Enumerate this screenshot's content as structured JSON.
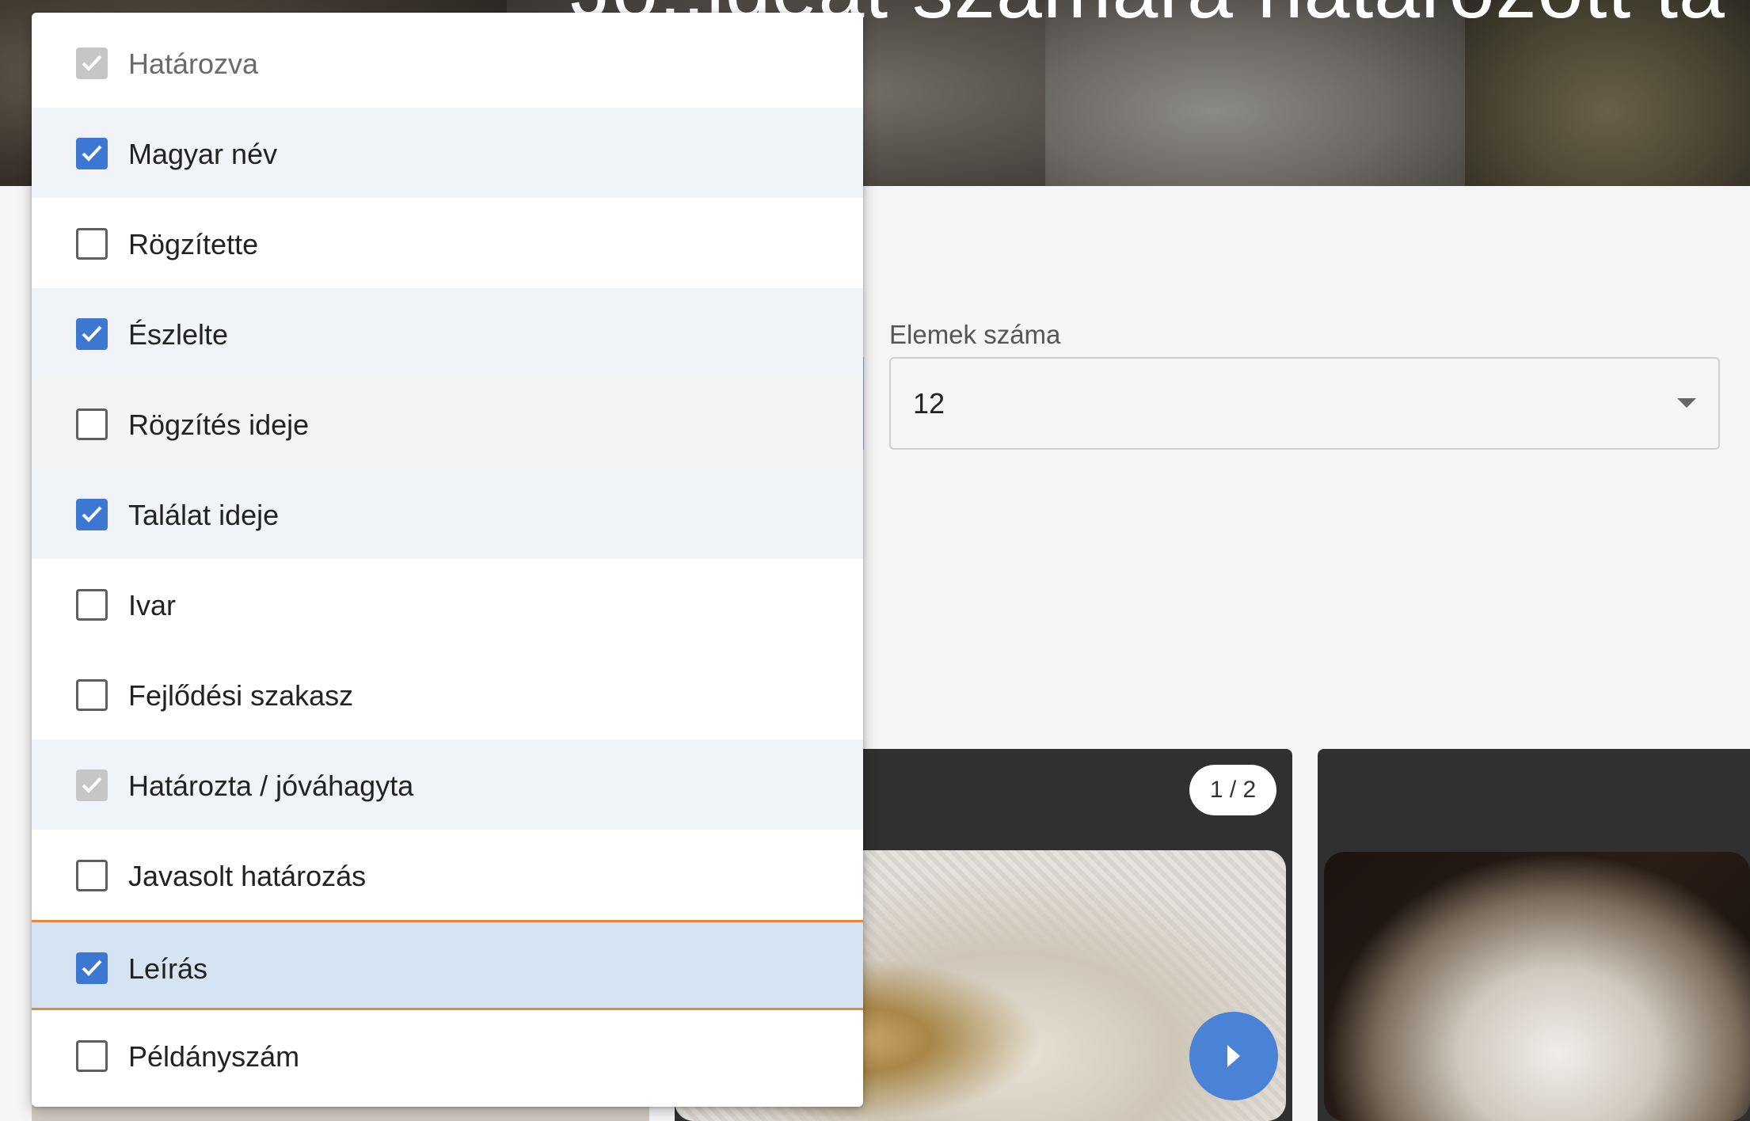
{
  "hero": {
    "title": "Jó..ldeat számára határozott ta"
  },
  "items_per_page": {
    "label": "Elemek száma",
    "value": "12"
  },
  "card": {
    "counter": "1 / 2"
  },
  "column_options": [
    {
      "label": "Határozva",
      "state": "checked-disabled"
    },
    {
      "label": "Magyar név",
      "state": "checked"
    },
    {
      "label": "Rögzítette",
      "state": "unchecked"
    },
    {
      "label": "Észlelte",
      "state": "checked"
    },
    {
      "label": "Rögzítés ideje",
      "state": "unchecked"
    },
    {
      "label": "Találat ideje",
      "state": "checked"
    },
    {
      "label": "Ivar",
      "state": "unchecked"
    },
    {
      "label": "Fejlődési szakasz",
      "state": "unchecked"
    },
    {
      "label": "Határozta / jóváhagyta",
      "state": "checked-disabled"
    },
    {
      "label": "Javasolt határozás",
      "state": "unchecked"
    },
    {
      "label": "Leírás",
      "state": "checked"
    },
    {
      "label": "Példányszám",
      "state": "unchecked"
    }
  ],
  "colors": {
    "accent": "#3c78d2",
    "focus_outline": "#e9873e",
    "selected_row": "#d6e3f3",
    "hover_row": "#f0f4f9",
    "card_header": "#303030",
    "next_button": "#4a82d6"
  },
  "icons": {
    "checkbox_checked": "check-icon",
    "next": "chevron-right-icon",
    "select_caret": "caret-down-icon"
  }
}
